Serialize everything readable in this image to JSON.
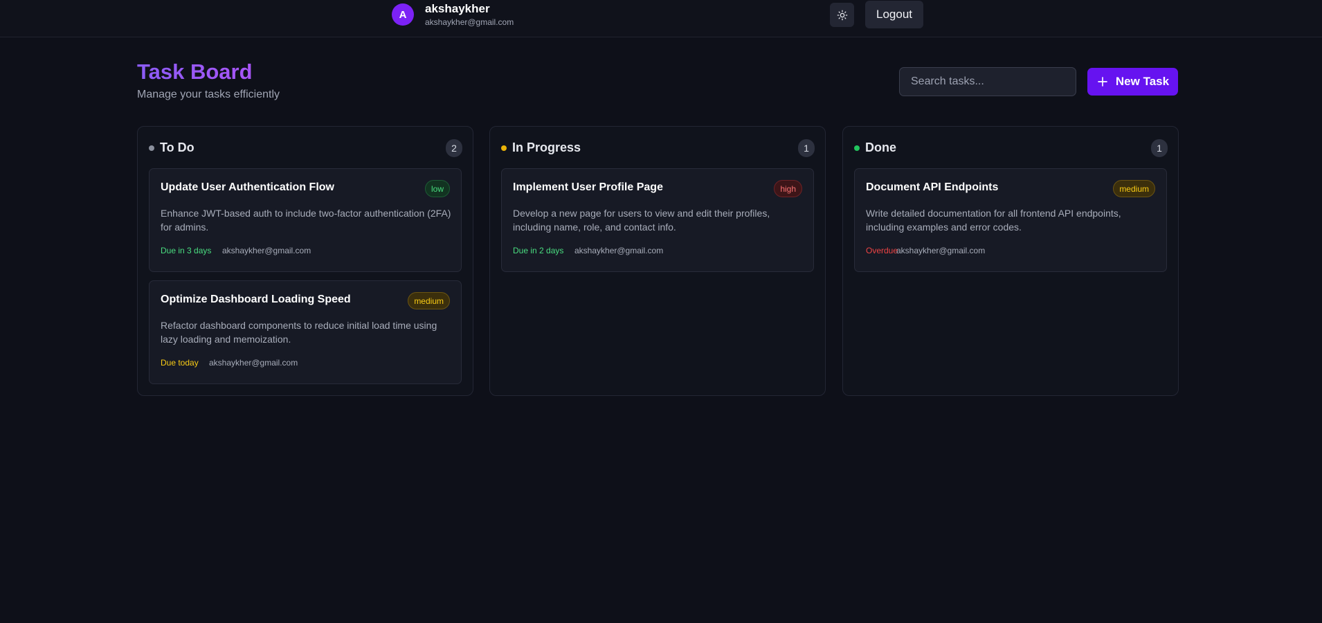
{
  "user": {
    "initial": "A",
    "name": "akshaykher",
    "email": "akshaykher@gmail.com"
  },
  "header": {
    "theme_toggle_icon": "sun-icon",
    "logout_label": "Logout"
  },
  "page": {
    "title": "Task Board",
    "subtitle": "Manage your tasks efficiently"
  },
  "search": {
    "placeholder": "Search tasks...",
    "value": ""
  },
  "new_task": {
    "label": "New Task",
    "icon": "plus-icon"
  },
  "colors": {
    "background": "#0e1019",
    "accent": "#6613f0",
    "todo_dot": "#8a8f9c",
    "in_progress_dot": "#eab308",
    "done_dot": "#22c55e",
    "due_ok": "#4ade80",
    "due_today": "#facc15",
    "overdue": "#ef4444"
  },
  "columns": [
    {
      "title": "To Do",
      "count": "2",
      "cards": [
        {
          "title": "Update User Authentication Flow",
          "priority": "low",
          "description": "Enhance JWT-based auth to include two-factor authentication (2FA) for admins.",
          "due": "Due in 3 days",
          "due_status": "ok",
          "assignee": "akshaykher@gmail.com"
        },
        {
          "title": "Optimize Dashboard Loading Speed",
          "priority": "medium",
          "description": "Refactor dashboard components to reduce initial load time using lazy loading and memoization.",
          "due": "Due today",
          "due_status": "today",
          "assignee": "akshaykher@gmail.com"
        }
      ]
    },
    {
      "title": "In Progress",
      "count": "1",
      "cards": [
        {
          "title": "Implement User Profile Page",
          "priority": "high",
          "description": "Develop a new page for users to view and edit their profiles, including name, role, and contact info.",
          "due": "Due in 2 days",
          "due_status": "ok",
          "assignee": "akshaykher@gmail.com"
        }
      ]
    },
    {
      "title": "Done",
      "count": "1",
      "cards": [
        {
          "title": "Document API Endpoints",
          "priority": "medium",
          "description": "Write detailed documentation for all frontend API endpoints, including examples and error codes.",
          "due": "Overdue",
          "due_status": "overdue",
          "assignee": "akshaykher@gmail.com"
        }
      ]
    }
  ]
}
